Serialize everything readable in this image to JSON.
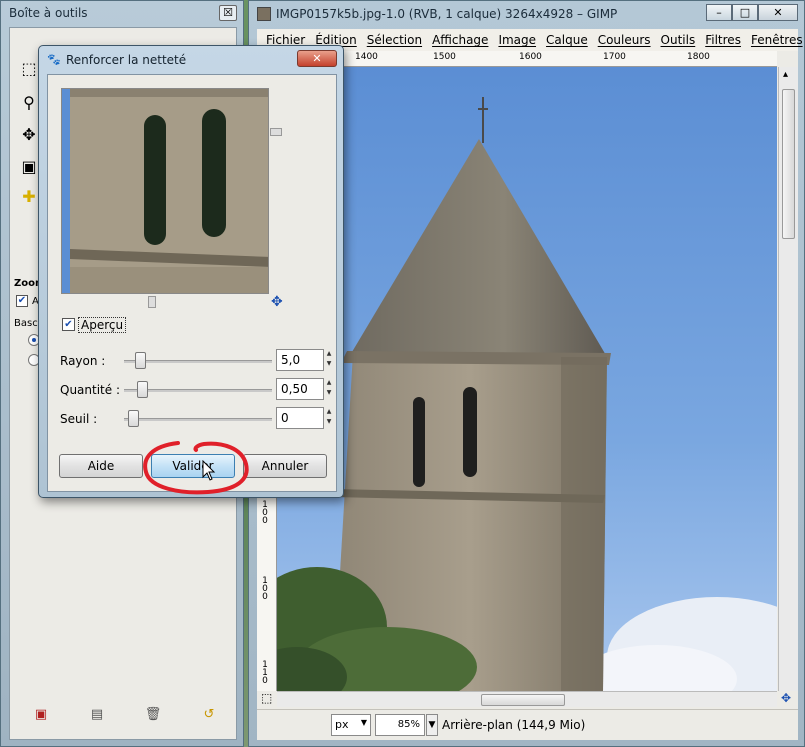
{
  "toolbox": {
    "title": "Boîte à outils",
    "close_glyph": "☒",
    "zoom_label": "Zoom",
    "check_label": "A",
    "bascule_label": "Bascu"
  },
  "image_window": {
    "title": "IMGP0157k5b.jpg-1.0 (RVB, 1 calque) 3264x4928 – GIMP",
    "menu": [
      "Fichier",
      "Édition",
      "Sélection",
      "Affichage",
      "Image",
      "Calque",
      "Couleurs",
      "Outils",
      "Filtres",
      "Fenêtres"
    ],
    "ruler_ticks": [
      "1400",
      "1500",
      "1600",
      "1700",
      "1800"
    ],
    "vruler_labels": [
      "1",
      "0",
      "0",
      "1",
      "0",
      "0",
      "1",
      "1",
      "0"
    ],
    "status": {
      "unit": "px",
      "zoom": "85%",
      "layer_info": "Arrière-plan (144,9 Mio)"
    }
  },
  "dialog": {
    "title": "Renforcer la netteté",
    "preview_label": "Aperçu",
    "preview_checked": true,
    "params": [
      {
        "label": "Rayon :",
        "value": "5,0",
        "fraction": 0.05
      },
      {
        "label": "Quantité :",
        "value": "0,50",
        "fraction": 0.06
      },
      {
        "label": "Seuil :",
        "value": "0",
        "fraction": 0.0
      }
    ],
    "buttons": {
      "help": "Aide",
      "ok": "Valider",
      "cancel": "Annuler"
    }
  },
  "colors": {
    "sky": "#5b8ed4",
    "annotation": "#e0202a",
    "accent": "#1a4fb0"
  }
}
